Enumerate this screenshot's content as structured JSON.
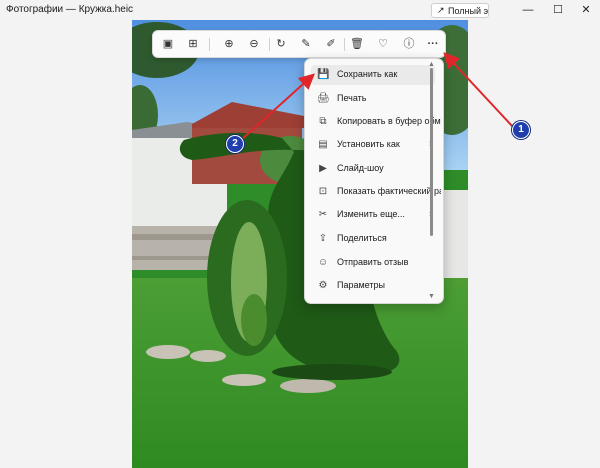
{
  "app": {
    "title": "Фотографии — Кружка.heic",
    "fullscreen_label": "Полный эк",
    "fullscreen_icon": "↗",
    "window_controls": {
      "minimize": "—",
      "maximize": "☐",
      "close": "✕"
    }
  },
  "toolbar": {
    "buttons": [
      {
        "name": "enhance-icon",
        "glyph": "▣"
      },
      {
        "name": "filters-icon",
        "glyph": "⊞"
      },
      {
        "name": "zoom-in-icon",
        "glyph": "⊕"
      },
      {
        "name": "zoom-out-icon",
        "glyph": "⊖"
      },
      {
        "name": "rotate-icon",
        "glyph": "↻"
      },
      {
        "name": "edit-icon",
        "glyph": "✎"
      },
      {
        "name": "draw-icon",
        "glyph": "✐"
      },
      {
        "name": "delete-icon",
        "glyph": "🗑"
      },
      {
        "name": "favorite-icon",
        "glyph": "♡"
      },
      {
        "name": "info-icon",
        "glyph": "ⓘ"
      },
      {
        "name": "more-icon",
        "glyph": "···"
      }
    ]
  },
  "menu": {
    "items": [
      {
        "label": "Сохранить как",
        "icon": "💾",
        "submenu": false
      },
      {
        "label": "Печать",
        "icon": "🖨",
        "submenu": false
      },
      {
        "label": "Копировать в буфер обмена",
        "icon": "⧉",
        "submenu": false
      },
      {
        "label": "Установить как",
        "icon": "▤",
        "submenu": true
      },
      {
        "label": "Слайд-шоу",
        "icon": "▶",
        "submenu": false
      },
      {
        "label": "Показать фактический размер",
        "icon": "⊡",
        "submenu": false
      },
      {
        "label": "Изменить еще...",
        "icon": "✂",
        "submenu": true
      },
      {
        "label": "Поделиться",
        "icon": "⇪",
        "submenu": false
      },
      {
        "label": "Отправить отзыв",
        "icon": "☺",
        "submenu": false
      },
      {
        "label": "Параметры",
        "icon": "⚙",
        "submenu": false
      }
    ],
    "scroll_up": "▲",
    "scroll_down": "▼"
  },
  "annotations": {
    "badge_1": "1",
    "badge_2": "2",
    "arrow_color": "#e0262b",
    "badge_color": "#1f3fae"
  }
}
